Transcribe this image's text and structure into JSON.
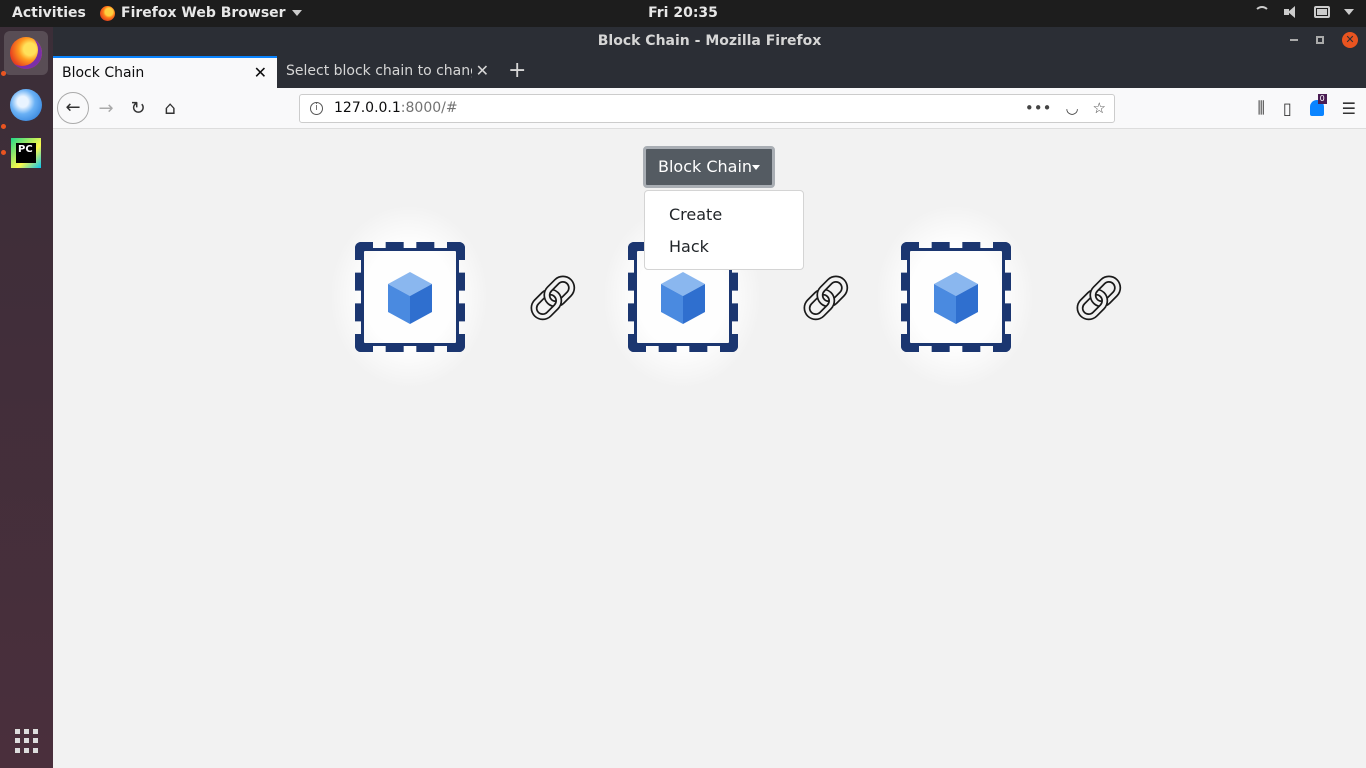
{
  "topbar": {
    "activities": "Activities",
    "app_name": "Firefox Web Browser",
    "clock": "Fri 20:35"
  },
  "window": {
    "title": "Block Chain - Mozilla Firefox"
  },
  "tabs": [
    {
      "title": "Block Chain",
      "active": true
    },
    {
      "title": "Select block chain to change",
      "active": false
    }
  ],
  "url": {
    "host": "127.0.0.1",
    "rest": ":8000/#"
  },
  "extension_badge": "0",
  "dropdown": {
    "label": "Block Chain",
    "items": [
      "Create",
      "Hack"
    ]
  },
  "blocks": [
    {
      "icon": "cube-icon"
    },
    {
      "icon": "cube-icon"
    },
    {
      "icon": "cube-icon"
    }
  ],
  "colors": {
    "dropdown_bg": "#545b62",
    "chain_color": "#1b3670",
    "cube_color": "#3a7bd5",
    "accent": "#0a84ff"
  }
}
